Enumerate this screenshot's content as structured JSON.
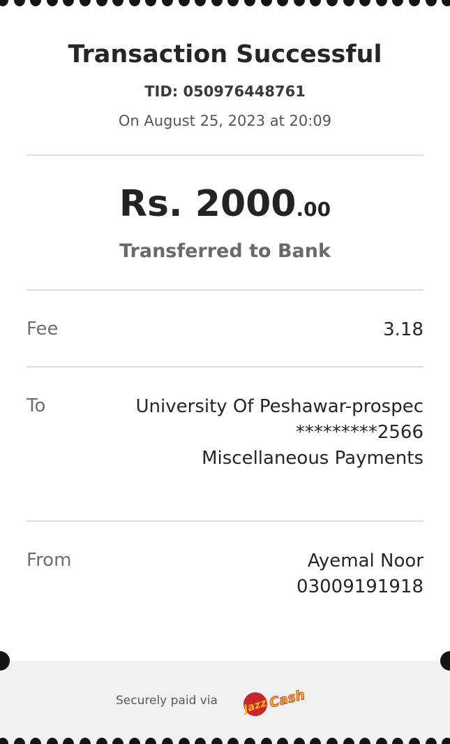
{
  "receipt": {
    "title": "Transaction Successful",
    "tid": "TID: 050976448761",
    "date": "On August 25, 2023 at 20:09",
    "amount": {
      "main": "Rs. 2000",
      "cents": ".00"
    },
    "amount_description": "Transferred to Bank"
  },
  "details": {
    "fee": {
      "label": "Fee",
      "value": "3.18"
    },
    "to": {
      "label": "To",
      "line1": "University Of Peshawar-prospec",
      "line2": "*********2566",
      "line3": "Miscellaneous Payments"
    },
    "from": {
      "label": "From",
      "line1": "Ayemal Noor",
      "line2": "03009191918"
    }
  },
  "footer": {
    "paid_via": "Securely paid via",
    "logo": {
      "name": "jazzcash-logo",
      "text_left": "Jazz",
      "text_right": "Cash"
    }
  },
  "colors": {
    "ink": "#262626",
    "muted": "#6e6e6e",
    "divider": "#dddddd",
    "footer_bg": "#f1f1f1",
    "logo_red": "#c9252c",
    "logo_yellow": "#f6b71a"
  }
}
